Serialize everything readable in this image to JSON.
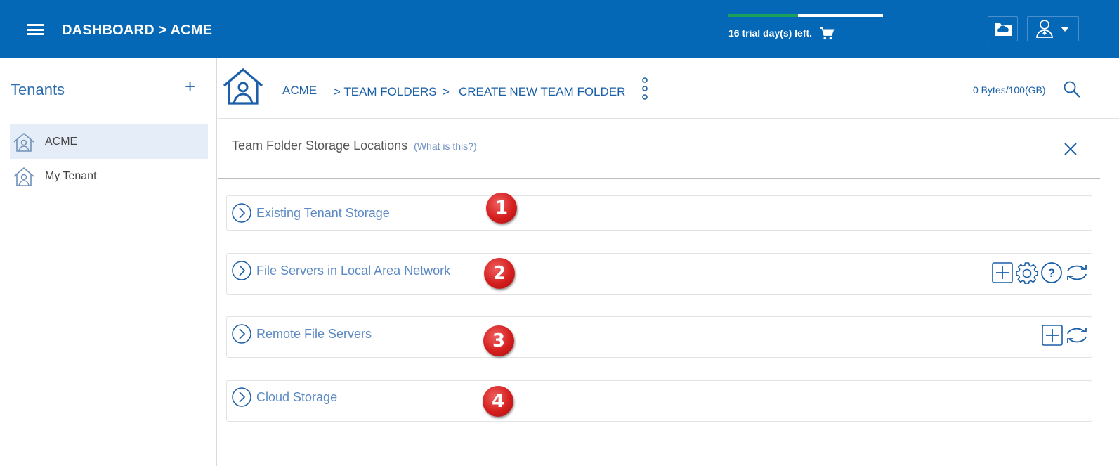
{
  "header": {
    "title": "DASHBOARD > ACME",
    "trial_text": "16 trial day(s) left.",
    "trial_progress": 0.45
  },
  "sidebar": {
    "title": "Tenants",
    "add_label": "+",
    "tenants": [
      {
        "label": "ACME",
        "active": true
      },
      {
        "label": "My Tenant",
        "active": false
      }
    ]
  },
  "breadcrumb": {
    "root": "ACME",
    "level1": "> TEAM FOLDERS",
    "separator": ">",
    "level2": "CREATE NEW TEAM FOLDER"
  },
  "storage_usage": "0 Bytes/100(GB)",
  "section": {
    "title": "Team Folder Storage Locations",
    "help_link": "(What is this?)"
  },
  "panels": [
    {
      "label": "Existing Tenant Storage",
      "badge": "1",
      "tools": []
    },
    {
      "label": "File Servers in Local Area Network",
      "badge": "2",
      "tools": [
        "add",
        "settings",
        "help",
        "refresh"
      ]
    },
    {
      "label": "Remote File Servers",
      "badge": "3",
      "tools": [
        "add",
        "refresh"
      ]
    },
    {
      "label": "Cloud Storage",
      "badge": "4",
      "tools": []
    }
  ],
  "colors": {
    "topbar": "#0568b7",
    "accent_text": "#1a5fa8",
    "link": "#5b89c4",
    "badge": "#d41e1e",
    "trial_fill": "#1aa05b"
  }
}
